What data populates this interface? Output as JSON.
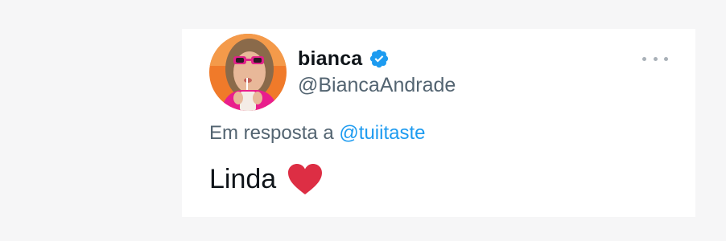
{
  "tweet": {
    "display_name": "bianca",
    "handle": "@BiancaAndrade",
    "verified": true,
    "reply_prefix": "Em resposta a",
    "reply_to": "@tuiitaste",
    "text": "Linda",
    "emoji": "heart-emoji",
    "more_icon": "more-horizontal-icon",
    "verified_icon": "verified-badge-icon"
  },
  "colors": {
    "link": "#1d9bf0",
    "secondary_text": "#536471",
    "primary_text": "#0f1419",
    "heart": "#dd2e44",
    "avatar_bg": "#f07a2a"
  }
}
